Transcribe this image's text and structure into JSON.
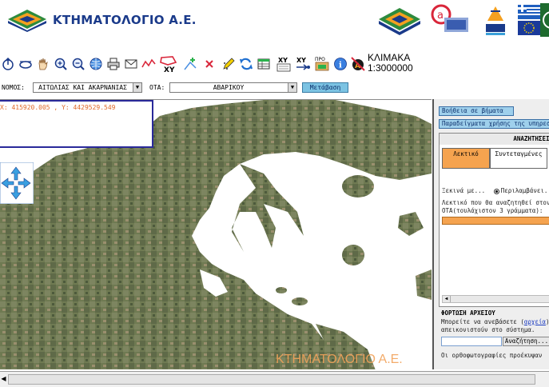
{
  "header": {
    "brand_text": "ΚΤΗΜΑΤΟΛΟΓΙΟ Α.Ε.",
    "partner_logos": [
      "ktimatologio-mark",
      "e-government-logo",
      "hellas-2006-logo",
      "greece-eu-flags",
      "green-seal-logo"
    ]
  },
  "toolbar": {
    "tools": [
      {
        "name": "pan-up-icon"
      },
      {
        "name": "pan-left-icon"
      },
      {
        "name": "hand-icon"
      },
      {
        "name": "zoom-in-icon"
      },
      {
        "name": "zoom-out-icon"
      },
      {
        "name": "globe-icon"
      },
      {
        "name": "print-icon"
      },
      {
        "name": "mail-icon"
      },
      {
        "name": "measure-line-icon"
      },
      {
        "name": "xy-polygon-icon"
      },
      {
        "name": "add-point-icon"
      },
      {
        "name": "clear-icon"
      },
      {
        "name": "pencil-icon"
      },
      {
        "name": "refresh-icon"
      },
      {
        "name": "table-icon"
      },
      {
        "name": "xy-list-icon"
      },
      {
        "name": "xy-goto-icon"
      },
      {
        "name": "open-file-icon"
      },
      {
        "name": "info-icon"
      },
      {
        "name": "scale-icon"
      }
    ],
    "xy_label": "XY",
    "scale_title": "ΚΛΙΜΑΚΑ",
    "scale_value": "1:3000000"
  },
  "selectors": {
    "nomos_label": "ΝΟΜΟΣ:",
    "nomos_value": "ΑΙΤΩΛΙΑΣ ΚΑΙ ΑΚΑΡΝΑΝΙΑΣ",
    "ota_label": "ΟΤΑ:",
    "ota_value": "ΑΒΑΡΙΚΟΥ",
    "go_button": "Μετάβαση"
  },
  "map": {
    "coordinates": "X: 415920.005 , Y: 4429529.549",
    "watermark": "ΚΤΗΜΑΤΟΛΟΓΙΟ Α.Ε."
  },
  "panel": {
    "help_button": "Βοήθεια σε βήματα",
    "examples_button": "Παραδείγματα χρήσης της υπηρεσίας",
    "search_title": "ΑΝΑΖΗΤΗΣΕΙΣ",
    "tab_lexical": "Λεκτικό",
    "tab_coordinates": "Συντεταγμένες",
    "starts_with": "Ξεκινά με...",
    "contains": "Περιλαμβάνει...",
    "search_hint_1": "Λεκτικό που θα αναζητηθεί στον",
    "search_hint_2": "ΟΤΑ(τουλάχιστον 3 γράμματα):",
    "upload_title": "ΦΟΡΤΩΣΗ ΑΡΧΕΙΟΥ",
    "upload_desc_1": "Μπορείτε να ανεβάσετε (",
    "upload_link": "αρχεία",
    "upload_desc_2": ") π",
    "upload_desc_3": "απεικονιστούν στο σύστημα.",
    "browse_button": "Αναζήτηση...",
    "footer_note": "Οι ορθοφωτογραφίες προέκυψαν"
  }
}
